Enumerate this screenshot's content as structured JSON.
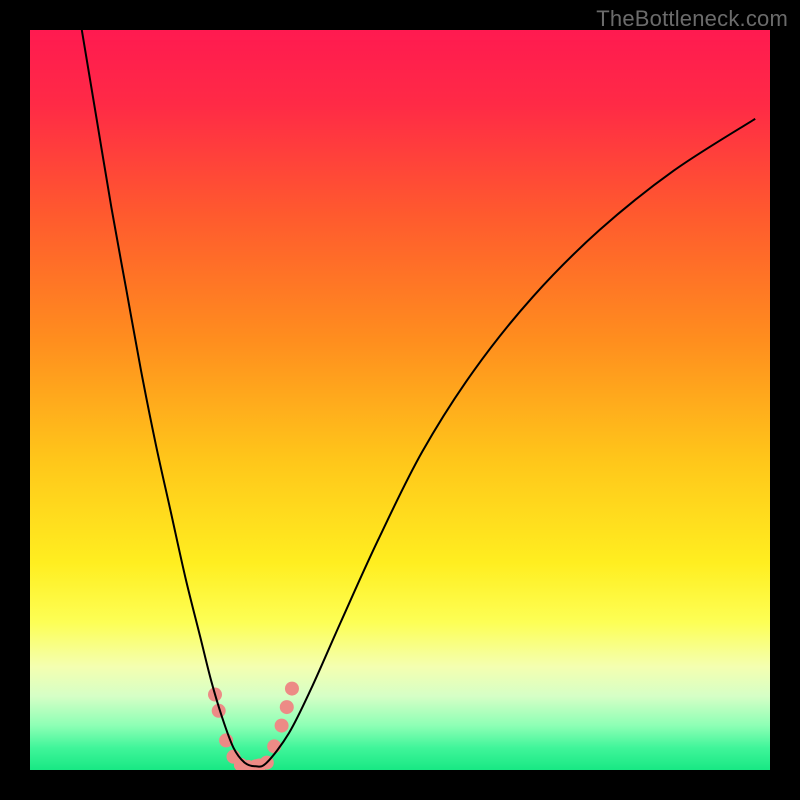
{
  "watermark": "TheBottleneck.com",
  "chart_data": {
    "type": "line",
    "title": "",
    "xlabel": "",
    "ylabel": "",
    "xlim": [
      0,
      100
    ],
    "ylim": [
      0,
      100
    ],
    "grid": false,
    "legend": false,
    "gradient_stops": [
      {
        "offset": 0.0,
        "color": "#ff1a50"
      },
      {
        "offset": 0.1,
        "color": "#ff2a46"
      },
      {
        "offset": 0.25,
        "color": "#ff5a2e"
      },
      {
        "offset": 0.42,
        "color": "#ff8e1e"
      },
      {
        "offset": 0.58,
        "color": "#ffc61a"
      },
      {
        "offset": 0.72,
        "color": "#ffee20"
      },
      {
        "offset": 0.8,
        "color": "#fdff55"
      },
      {
        "offset": 0.86,
        "color": "#f4ffb0"
      },
      {
        "offset": 0.9,
        "color": "#d6ffc6"
      },
      {
        "offset": 0.94,
        "color": "#8dffb5"
      },
      {
        "offset": 0.97,
        "color": "#40f59a"
      },
      {
        "offset": 1.0,
        "color": "#18e884"
      }
    ],
    "series": [
      {
        "name": "bottleneck-curve",
        "color": "#000000",
        "width": 2,
        "x": [
          7,
          9,
          11,
          13,
          15,
          17,
          19,
          21,
          23,
          24.5,
          26,
          27.5,
          29,
          30.5,
          32,
          35,
          38,
          42,
          47,
          53,
          60,
          68,
          77,
          87,
          98
        ],
        "y": [
          100,
          88,
          76,
          65,
          54,
          44,
          35,
          26,
          18,
          12,
          7,
          3,
          1,
          0.5,
          1,
          5,
          11,
          20,
          31,
          43,
          54,
          64,
          73,
          81,
          88
        ]
      }
    ],
    "overlay_points": {
      "name": "sample-dots",
      "color": "#ed8b86",
      "radius": 7,
      "x": [
        25.0,
        25.5,
        26.5,
        27.5,
        28.5,
        29.5,
        30.5,
        31.0,
        32.0,
        33.0,
        34.0,
        34.7,
        35.4
      ],
      "y": [
        10.2,
        8.0,
        4.0,
        1.8,
        0.7,
        0.4,
        0.5,
        0.6,
        1.0,
        3.2,
        6.0,
        8.5,
        11.0
      ]
    }
  }
}
